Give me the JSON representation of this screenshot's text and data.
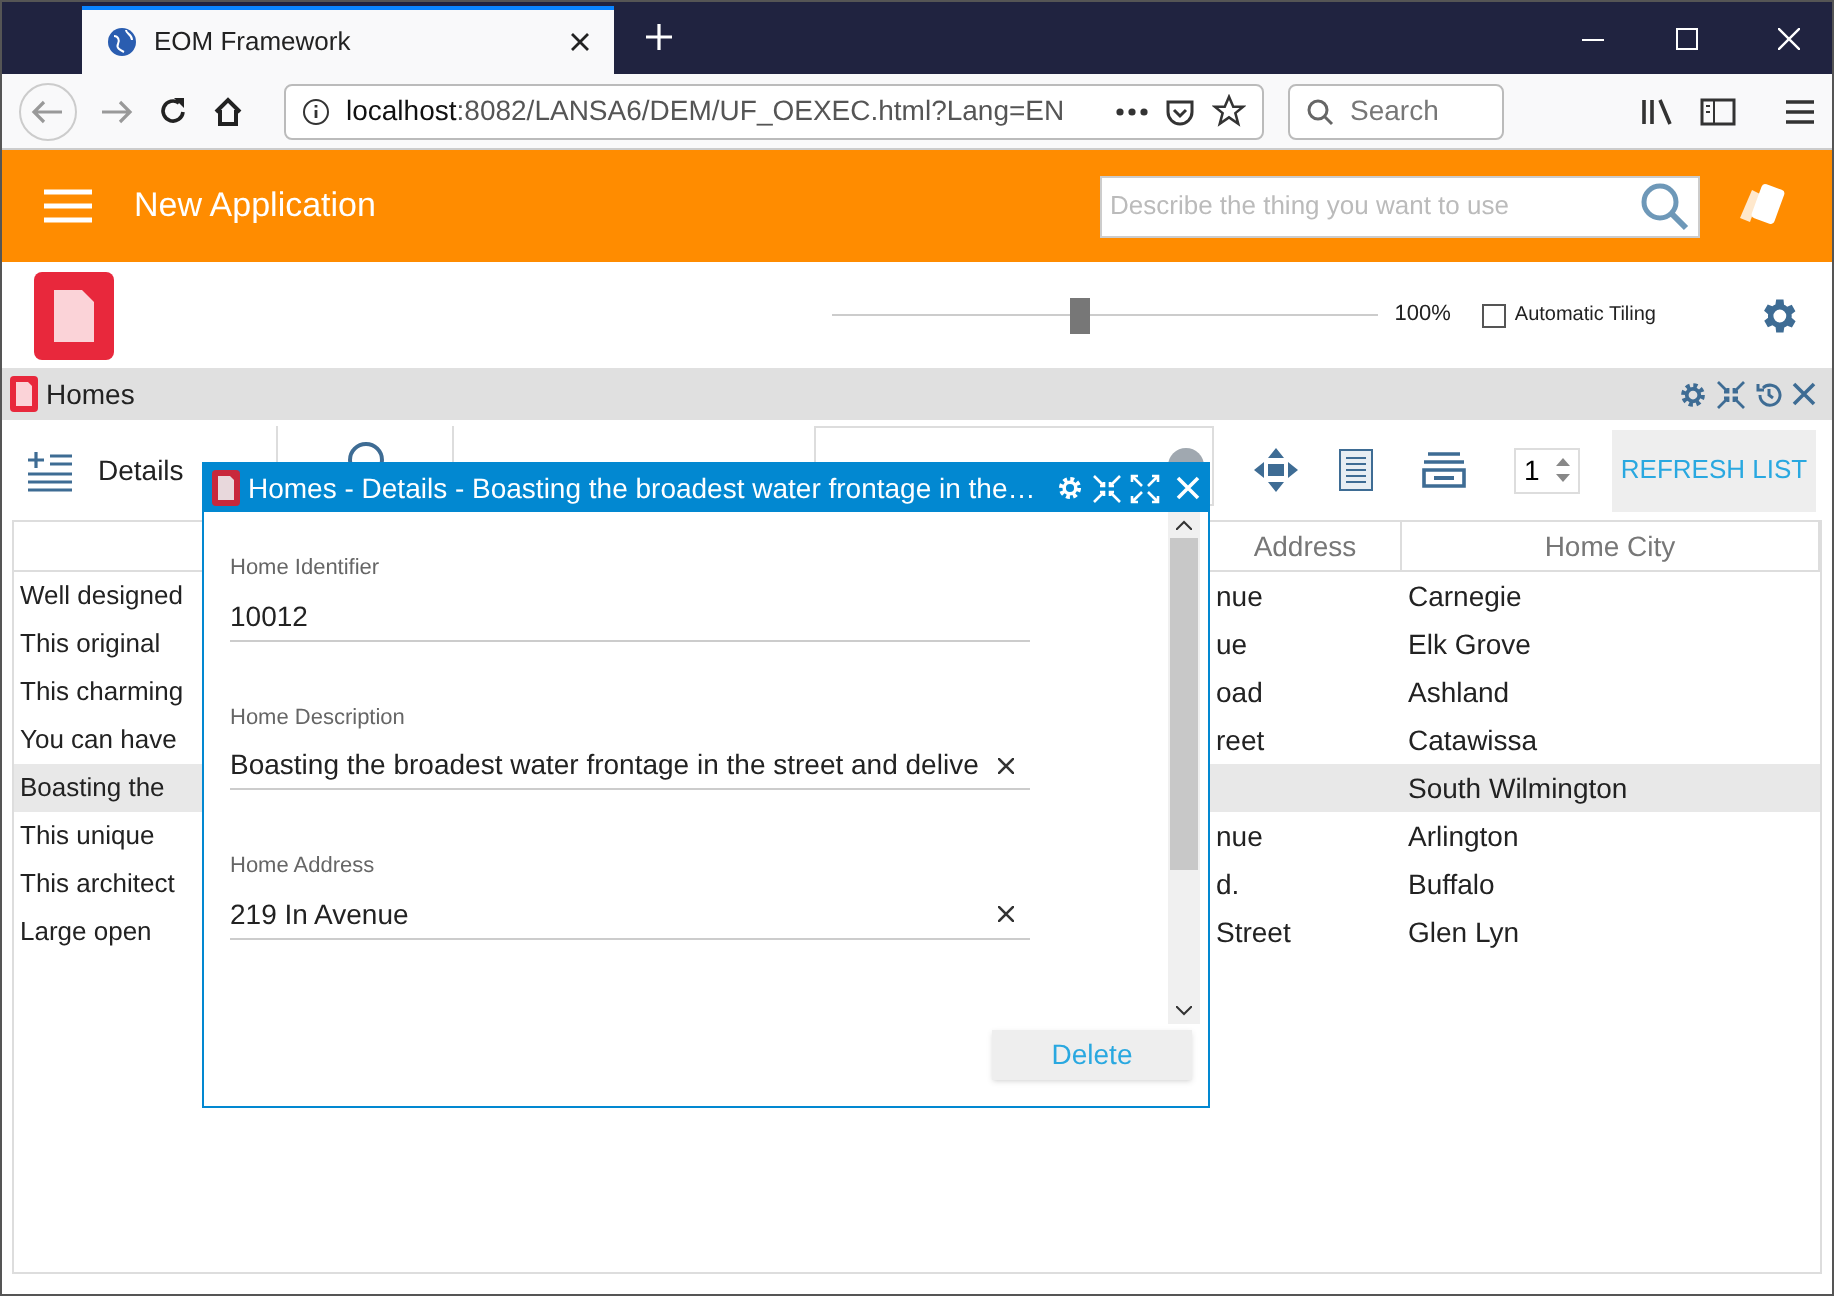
{
  "browser": {
    "tab_title": "EOM Framework",
    "url_host": "localhost",
    "url_rest": ":8082/LANSA6/DEM/UF_OEXEC.html?Lang=EN",
    "search_placeholder": "Search"
  },
  "app_bar": {
    "title": "New Application",
    "search_placeholder": "Describe the thing you want to use"
  },
  "controls": {
    "zoom": {
      "level": 0.45
    },
    "zoom_reading": "100%",
    "auto_tiling": {
      "label": "Automatic Tiling",
      "checked": false
    }
  },
  "panel": {
    "title": "Homes",
    "toolbar": {
      "details_label": "Details",
      "page_number": "1",
      "refresh_label": "REFRESH LIST"
    },
    "table": {
      "columns": [
        "",
        "Address",
        "Home City"
      ],
      "rows": [
        {
          "cells": [
            "Well designed",
            "nue",
            "Carnegie"
          ],
          "selected": false
        },
        {
          "cells": [
            "This original",
            "ue",
            "Elk Grove"
          ],
          "selected": false
        },
        {
          "cells": [
            "This charming",
            "oad",
            "Ashland"
          ],
          "selected": false
        },
        {
          "cells": [
            "You can have",
            "reet",
            "Catawissa"
          ],
          "selected": false
        },
        {
          "cells": [
            "Boasting the",
            "",
            "South Wilmington"
          ],
          "selected": true
        },
        {
          "cells": [
            "This unique",
            "nue",
            "Arlington"
          ],
          "selected": false
        },
        {
          "cells": [
            "This architect",
            "d.",
            "Buffalo"
          ],
          "selected": false
        },
        {
          "cells": [
            "Large open",
            "Street",
            "Glen Lyn"
          ],
          "selected": false
        }
      ]
    }
  },
  "dialog": {
    "title": "Homes - Details - Boasting the broadest water frontage in the…",
    "fields": [
      {
        "label": "Home Identifier",
        "value": "10012",
        "clearable": false
      },
      {
        "label": "Home Description",
        "value": "Boasting the broadest water frontage in the street and delive",
        "clearable": true
      },
      {
        "label": "Home Address",
        "value": "219 In Avenue",
        "clearable": true
      }
    ],
    "delete_label": "Delete"
  }
}
